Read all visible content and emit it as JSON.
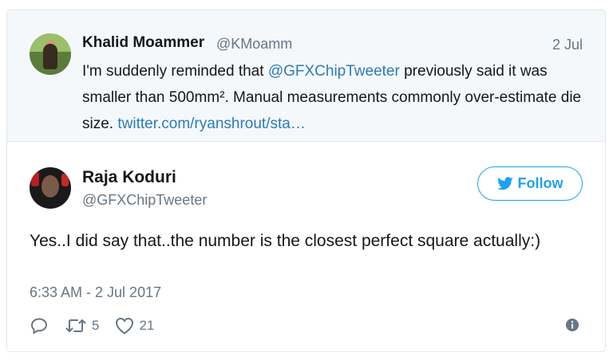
{
  "quoted_tweet": {
    "name": "Khalid Moammer",
    "handle": "@KMoamm",
    "date": "2 Jul",
    "text_before": "I'm suddenly reminded that ",
    "mention": "@GFXChipTweeter",
    "text_after": " previously said it was smaller than 500mm². Manual measurements commonly over-estimate die size. ",
    "link": "twitter.com/ryanshrout/sta…",
    "avatar_icon": "user-avatar"
  },
  "tweet": {
    "name": "Raja Koduri",
    "handle": "@GFXChipTweeter",
    "text": "Yes..I did say that..the number is the closest perfect square actually:)",
    "timestamp": "6:33 AM - 2 Jul 2017",
    "avatar_icon": "user-avatar",
    "follow_label": "Follow",
    "follow_icon": "twitter-bird-icon",
    "retweets": "5",
    "likes": "21",
    "reply_icon": "reply-icon",
    "retweet_icon": "retweet-icon",
    "like_icon": "heart-icon",
    "info_icon": "info-icon"
  },
  "colors": {
    "accent": "#1da1f2",
    "link": "#2b7bb9",
    "muted": "#657786",
    "quoted_bg": "#f5f8fa"
  }
}
